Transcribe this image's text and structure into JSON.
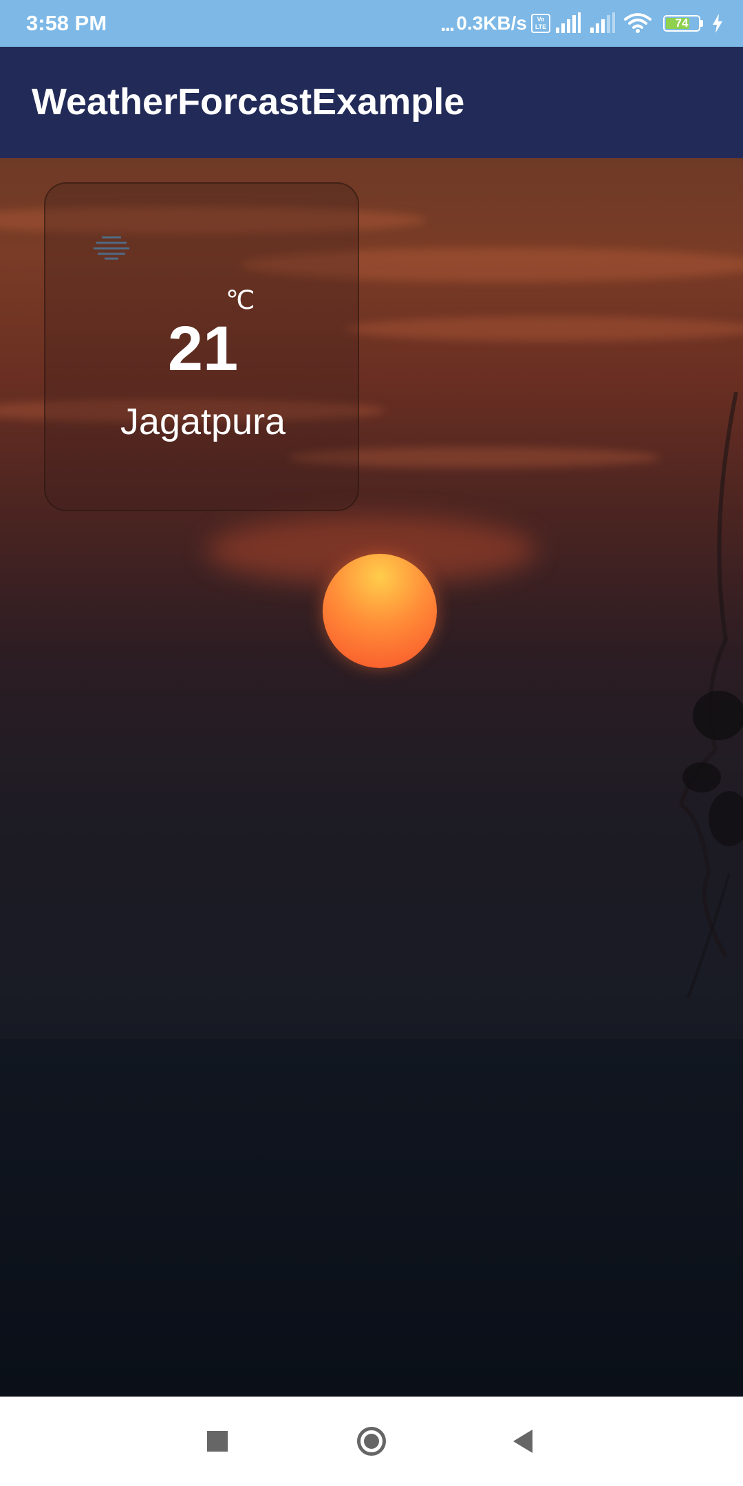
{
  "status_bar": {
    "time": "3:58 PM",
    "dots": "...",
    "network_speed": "0.3KB/s",
    "volte_top": "Vo",
    "volte_bottom": "LTE",
    "battery_level": "74",
    "battery_fraction": 0.74,
    "battery_color": "#8fd14f",
    "icons": [
      "volte-icon",
      "signal-icon",
      "signal-icon",
      "wifi-icon",
      "battery-icon",
      "charging-icon"
    ]
  },
  "app_bar": {
    "title": "WeatherForcastExample",
    "background": "#222b58"
  },
  "weather": {
    "icon": "haze-icon",
    "temperature": "21",
    "unit": "℃",
    "city": "Jagatpura"
  },
  "nav_bar": {
    "icons": [
      "recents-icon",
      "home-icon",
      "back-icon"
    ]
  }
}
